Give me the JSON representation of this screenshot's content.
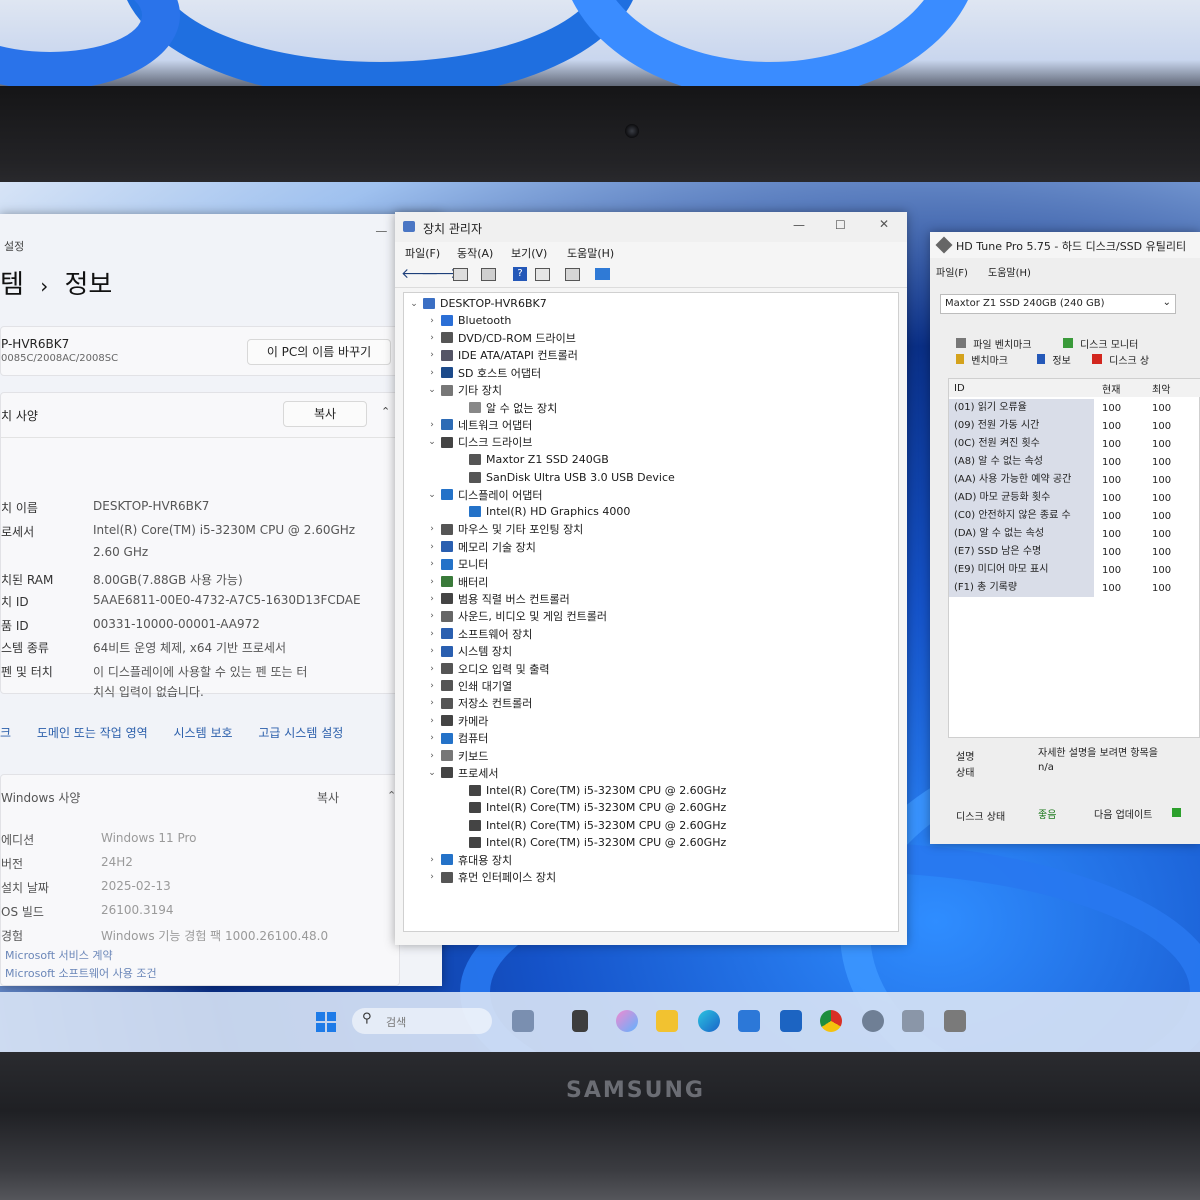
{
  "brand": "SAMSUNG",
  "settings": {
    "app_label": "설정",
    "breadcrumb_parent": "템",
    "breadcrumb_sep": "›",
    "breadcrumb_current": "정보",
    "pc_name_short": "P-HVR6BK7",
    "pc_model": "0085C/2008AC/2008SC",
    "rename_button": "이 PC의 이름 바꾸기",
    "device_spec_header": "치 사양",
    "copy_button": "복사",
    "specs": [
      {
        "label": "치 이름",
        "value": "DESKTOP-HVR6BK7"
      },
      {
        "label": "로세서",
        "value": "Intel(R) Core(TM) i5-3230M CPU @ 2.60GHz"
      },
      {
        "label": "",
        "value": "2.60 GHz"
      },
      {
        "label": "치된 RAM",
        "value": "8.00GB(7.88GB 사용 가능)"
      },
      {
        "label": "치 ID",
        "value": "5AAE6811-00E0-4732-A7C5-1630D13FCDAE"
      },
      {
        "label": "품 ID",
        "value": "00331-10000-00001-AA972"
      },
      {
        "label": "스템 종류",
        "value": "64비트 운영 체제, x64 기반 프로세서"
      },
      {
        "label": "펜 및 터치",
        "value": "이 디스플레이에 사용할 수 있는 펜 또는 터"
      },
      {
        "label": "",
        "value": "치식 입력이 없습니다."
      }
    ],
    "links": [
      "크",
      "도메인 또는 작업 영역",
      "시스템 보호",
      "고급 시스템 설정"
    ],
    "windows_spec_header": "Windows 사양",
    "windows_copy": "복사",
    "win_specs": [
      {
        "label": "에디션",
        "value": "Windows 11 Pro"
      },
      {
        "label": "버전",
        "value": "24H2"
      },
      {
        "label": "설치 날짜",
        "value": "2025-02-13"
      },
      {
        "label": "OS 빌드",
        "value": "26100.3194"
      },
      {
        "label": "경험",
        "value": "Windows 기능 경험 팩 1000.26100.48.0"
      }
    ],
    "footer_links": [
      "Microsoft 서비스 계약",
      "Microsoft 소프트웨어 사용 조건"
    ]
  },
  "devmgr": {
    "title": "장치 관리자",
    "menu": [
      "파일(F)",
      "동작(A)",
      "보기(V)",
      "도움말(H)"
    ],
    "root": "DESKTOP-HVR6BK7",
    "rows": [
      {
        "level": 1,
        "arrow": "›",
        "label": "Bluetooth",
        "icon_color": "#2b6fd6"
      },
      {
        "level": 1,
        "arrow": "›",
        "label": "DVD/CD-ROM 드라이브",
        "icon_color": "#555"
      },
      {
        "level": 1,
        "arrow": "›",
        "label": "IDE ATA/ATAPI 컨트롤러",
        "icon_color": "#556"
      },
      {
        "level": 1,
        "arrow": "›",
        "label": "SD 호스트 어댑터",
        "icon_color": "#1c4a8a"
      },
      {
        "level": 1,
        "arrow": "⌄",
        "label": "기타 장치",
        "icon_color": "#777"
      },
      {
        "level": 2,
        "arrow": "",
        "label": "알 수 없는 장치",
        "icon_color": "#888"
      },
      {
        "level": 1,
        "arrow": "›",
        "label": "네트워크 어댑터",
        "icon_color": "#2d6bb5"
      },
      {
        "level": 1,
        "arrow": "⌄",
        "label": "디스크 드라이브",
        "icon_color": "#444"
      },
      {
        "level": 2,
        "arrow": "",
        "label": "Maxtor Z1 SSD 240GB",
        "icon_color": "#555"
      },
      {
        "level": 2,
        "arrow": "",
        "label": "SanDisk Ultra USB 3.0 USB Device",
        "icon_color": "#555"
      },
      {
        "level": 1,
        "arrow": "⌄",
        "label": "디스플레이 어댑터",
        "icon_color": "#2472c8"
      },
      {
        "level": 2,
        "arrow": "",
        "label": "Intel(R) HD Graphics 4000",
        "icon_color": "#2472c8"
      },
      {
        "level": 1,
        "arrow": "›",
        "label": "마우스 및 기타 포인팅 장치",
        "icon_color": "#555"
      },
      {
        "level": 1,
        "arrow": "›",
        "label": "메모리 기술 장치",
        "icon_color": "#2a5fb0"
      },
      {
        "level": 1,
        "arrow": "›",
        "label": "모니터",
        "icon_color": "#2472c8"
      },
      {
        "level": 1,
        "arrow": "›",
        "label": "배터리",
        "icon_color": "#3a7a3a"
      },
      {
        "level": 1,
        "arrow": "›",
        "label": "범용 직렬 버스 컨트롤러",
        "icon_color": "#444"
      },
      {
        "level": 1,
        "arrow": "›",
        "label": "사운드, 비디오 및 게임 컨트롤러",
        "icon_color": "#666"
      },
      {
        "level": 1,
        "arrow": "›",
        "label": "소프트웨어 장치",
        "icon_color": "#2a5fb0"
      },
      {
        "level": 1,
        "arrow": "›",
        "label": "시스템 장치",
        "icon_color": "#2a5fb0"
      },
      {
        "level": 1,
        "arrow": "›",
        "label": "오디오 입력 및 출력",
        "icon_color": "#555"
      },
      {
        "level": 1,
        "arrow": "›",
        "label": "인쇄 대기열",
        "icon_color": "#555"
      },
      {
        "level": 1,
        "arrow": "›",
        "label": "저장소 컨트롤러",
        "icon_color": "#555"
      },
      {
        "level": 1,
        "arrow": "›",
        "label": "카메라",
        "icon_color": "#444"
      },
      {
        "level": 1,
        "arrow": "›",
        "label": "컴퓨터",
        "icon_color": "#2472c8"
      },
      {
        "level": 1,
        "arrow": "›",
        "label": "키보드",
        "icon_color": "#777"
      },
      {
        "level": 1,
        "arrow": "⌄",
        "label": "프로세서",
        "icon_color": "#444"
      },
      {
        "level": 2,
        "arrow": "",
        "label": "Intel(R) Core(TM) i5-3230M CPU @ 2.60GHz",
        "icon_color": "#444"
      },
      {
        "level": 2,
        "arrow": "",
        "label": "Intel(R) Core(TM) i5-3230M CPU @ 2.60GHz",
        "icon_color": "#444"
      },
      {
        "level": 2,
        "arrow": "",
        "label": "Intel(R) Core(TM) i5-3230M CPU @ 2.60GHz",
        "icon_color": "#444"
      },
      {
        "level": 2,
        "arrow": "",
        "label": "Intel(R) Core(TM) i5-3230M CPU @ 2.60GHz",
        "icon_color": "#444"
      },
      {
        "level": 1,
        "arrow": "›",
        "label": "휴대용 장치",
        "icon_color": "#2472c8"
      },
      {
        "level": 1,
        "arrow": "›",
        "label": "휴먼 인터페이스 장치",
        "icon_color": "#555"
      }
    ]
  },
  "hdtune": {
    "title": "HD Tune Pro 5.75 - 하드 디스크/SSD 유틸리티",
    "menu": [
      "파일(F)",
      "도움말(H)"
    ],
    "drive": "Maxtor Z1 SSD 240GB (240 GB)",
    "tabs_row1": [
      "파일 벤치마크",
      "디스크 모니터"
    ],
    "tabs_row2": [
      "벤치마크",
      "정보",
      "디스크 상"
    ],
    "columns": [
      "ID",
      "현재",
      "최악"
    ],
    "rows": [
      {
        "id": "(01) 읽기 오류율",
        "cur": "100",
        "worst": "100"
      },
      {
        "id": "(09) 전원 가동 시간",
        "cur": "100",
        "worst": "100"
      },
      {
        "id": "(0C) 전원 켜진 횟수",
        "cur": "100",
        "worst": "100"
      },
      {
        "id": "(A8) 알 수 없는 속성",
        "cur": "100",
        "worst": "100"
      },
      {
        "id": "(AA) 사용 가능한 예약 공간",
        "cur": "100",
        "worst": "100"
      },
      {
        "id": "(AD) 마모 균등화 횟수",
        "cur": "100",
        "worst": "100"
      },
      {
        "id": "(C0) 안전하지 않은 종료 수",
        "cur": "100",
        "worst": "100"
      },
      {
        "id": "(DA) 알 수 없는 속성",
        "cur": "100",
        "worst": "100"
      },
      {
        "id": "(E7) SSD 남은 수명",
        "cur": "100",
        "worst": "100"
      },
      {
        "id": "(E9) 미디어 마모 표시",
        "cur": "100",
        "worst": "100"
      },
      {
        "id": "(F1) 총 기록량",
        "cur": "100",
        "worst": "100"
      }
    ],
    "desc_label": "설명",
    "desc_value": "자세한 설명을 보려면 항목을",
    "status_label": "상태",
    "status_value": "n/a",
    "health_label": "디스크 상태",
    "health_value": "좋음",
    "next_update": "다음 업데이트"
  },
  "taskbar": {
    "search_placeholder": "검색"
  }
}
